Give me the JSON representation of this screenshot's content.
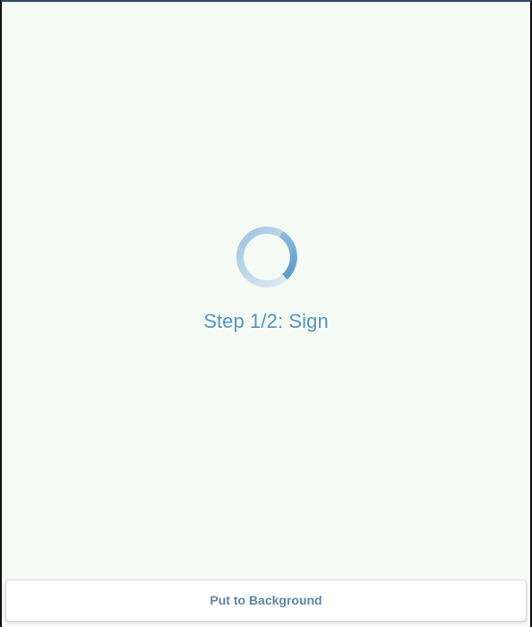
{
  "status": {
    "step_text": "Step 1/2: Sign",
    "spinner_icon": "loading-spinner-icon"
  },
  "footer": {
    "background_button_label": "Put to Background"
  },
  "colors": {
    "background": "#f5faf5",
    "accent": "#5896c3",
    "button_text": "#5a86a8"
  }
}
